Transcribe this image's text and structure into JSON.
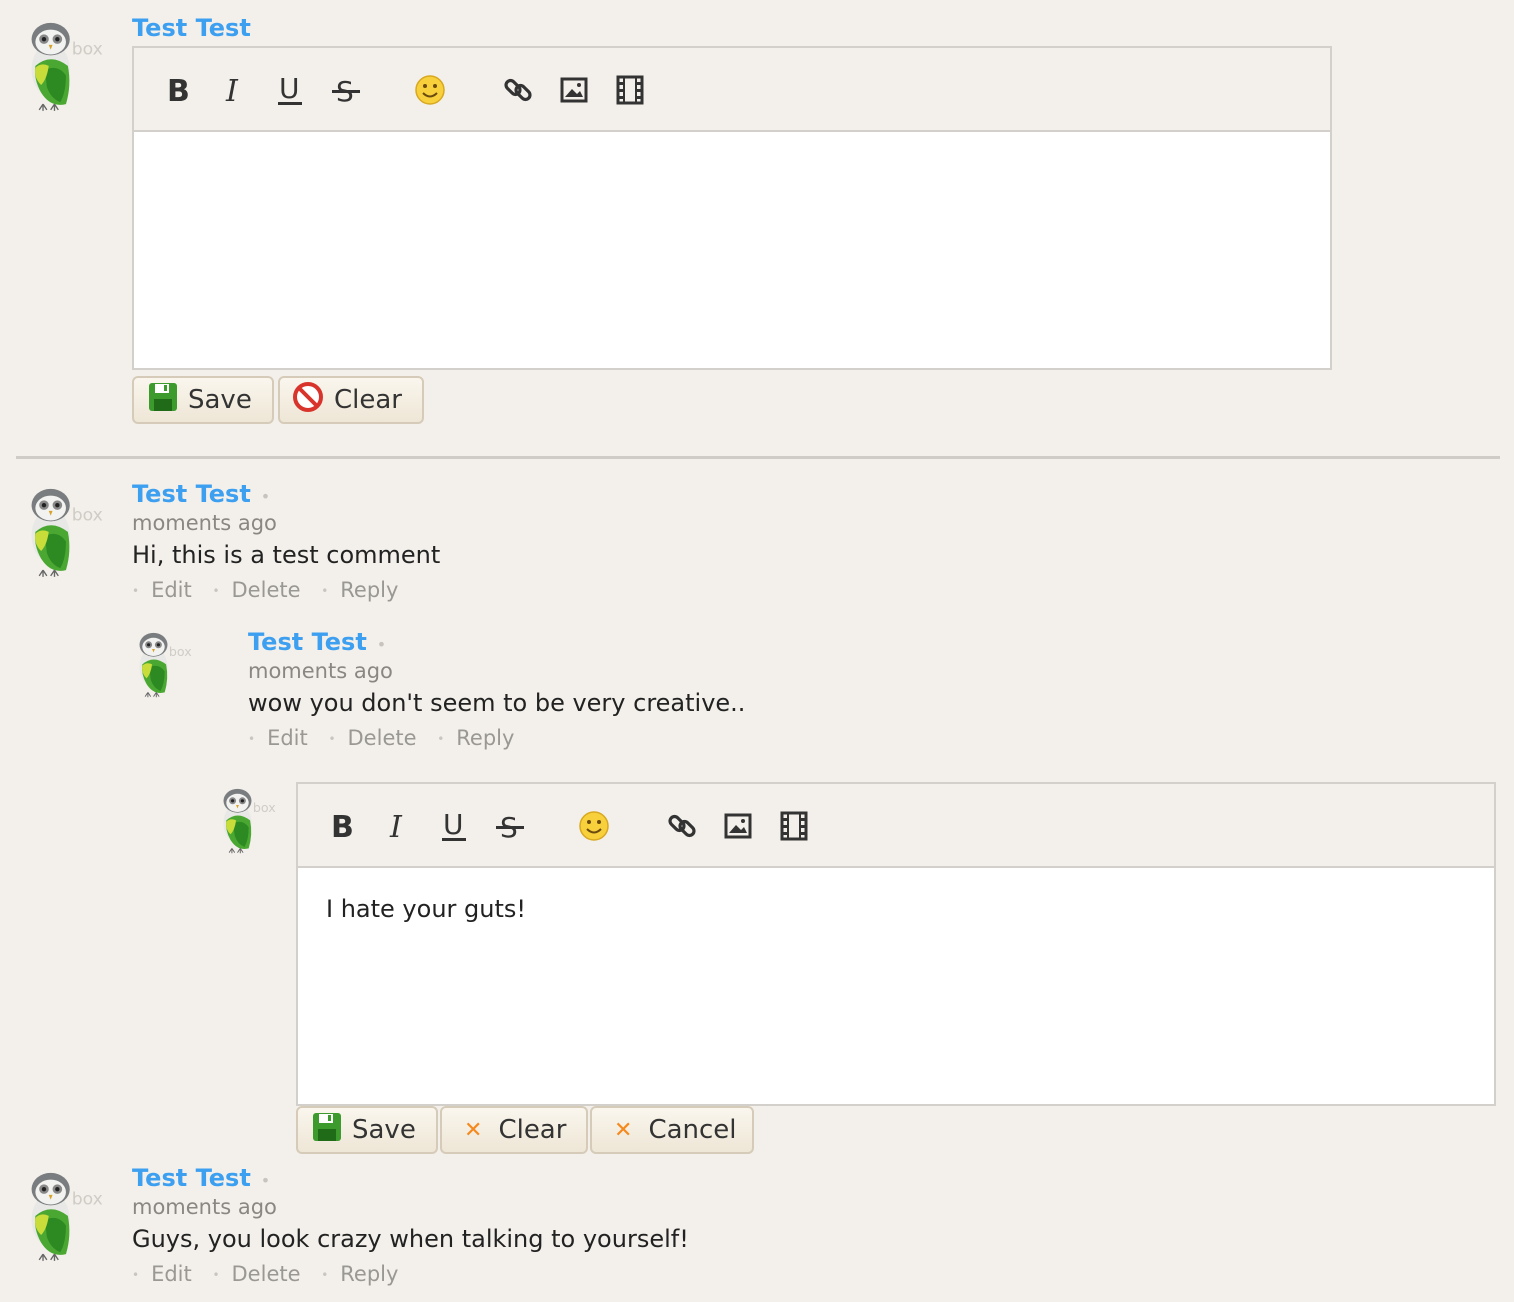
{
  "avatar_watermark": "box",
  "new_comment": {
    "author": "Test Test",
    "editor_text": "",
    "save_label": "Save",
    "clear_label": "Clear"
  },
  "comments": [
    {
      "author": "Test Test",
      "timestamp": "moments ago",
      "text": "Hi, this is a test comment",
      "actions": [
        "Edit",
        "Delete",
        "Reply"
      ]
    },
    {
      "author": "Test Test",
      "timestamp": "moments ago",
      "text": "wow you don't seem to be very creative..",
      "actions": [
        "Edit",
        "Delete",
        "Reply"
      ]
    },
    {
      "author": "Test Test",
      "timestamp": "moments ago",
      "text": "Guys, you look crazy when talking to yourself!",
      "actions": [
        "Edit",
        "Delete",
        "Reply"
      ]
    }
  ],
  "reply_editor": {
    "text": "I hate your guts!",
    "save_label": "Save",
    "clear_label": "Clear",
    "cancel_label": "Cancel"
  },
  "toolbar_icons": [
    "bold-icon",
    "italic-icon",
    "underline-icon",
    "strikethrough-icon",
    "smiley-icon",
    "link-icon",
    "image-icon",
    "video-icon"
  ],
  "colors": {
    "author": "#3d9ff0",
    "background": "#f3f0eb",
    "x_icon": "#f5891e"
  }
}
